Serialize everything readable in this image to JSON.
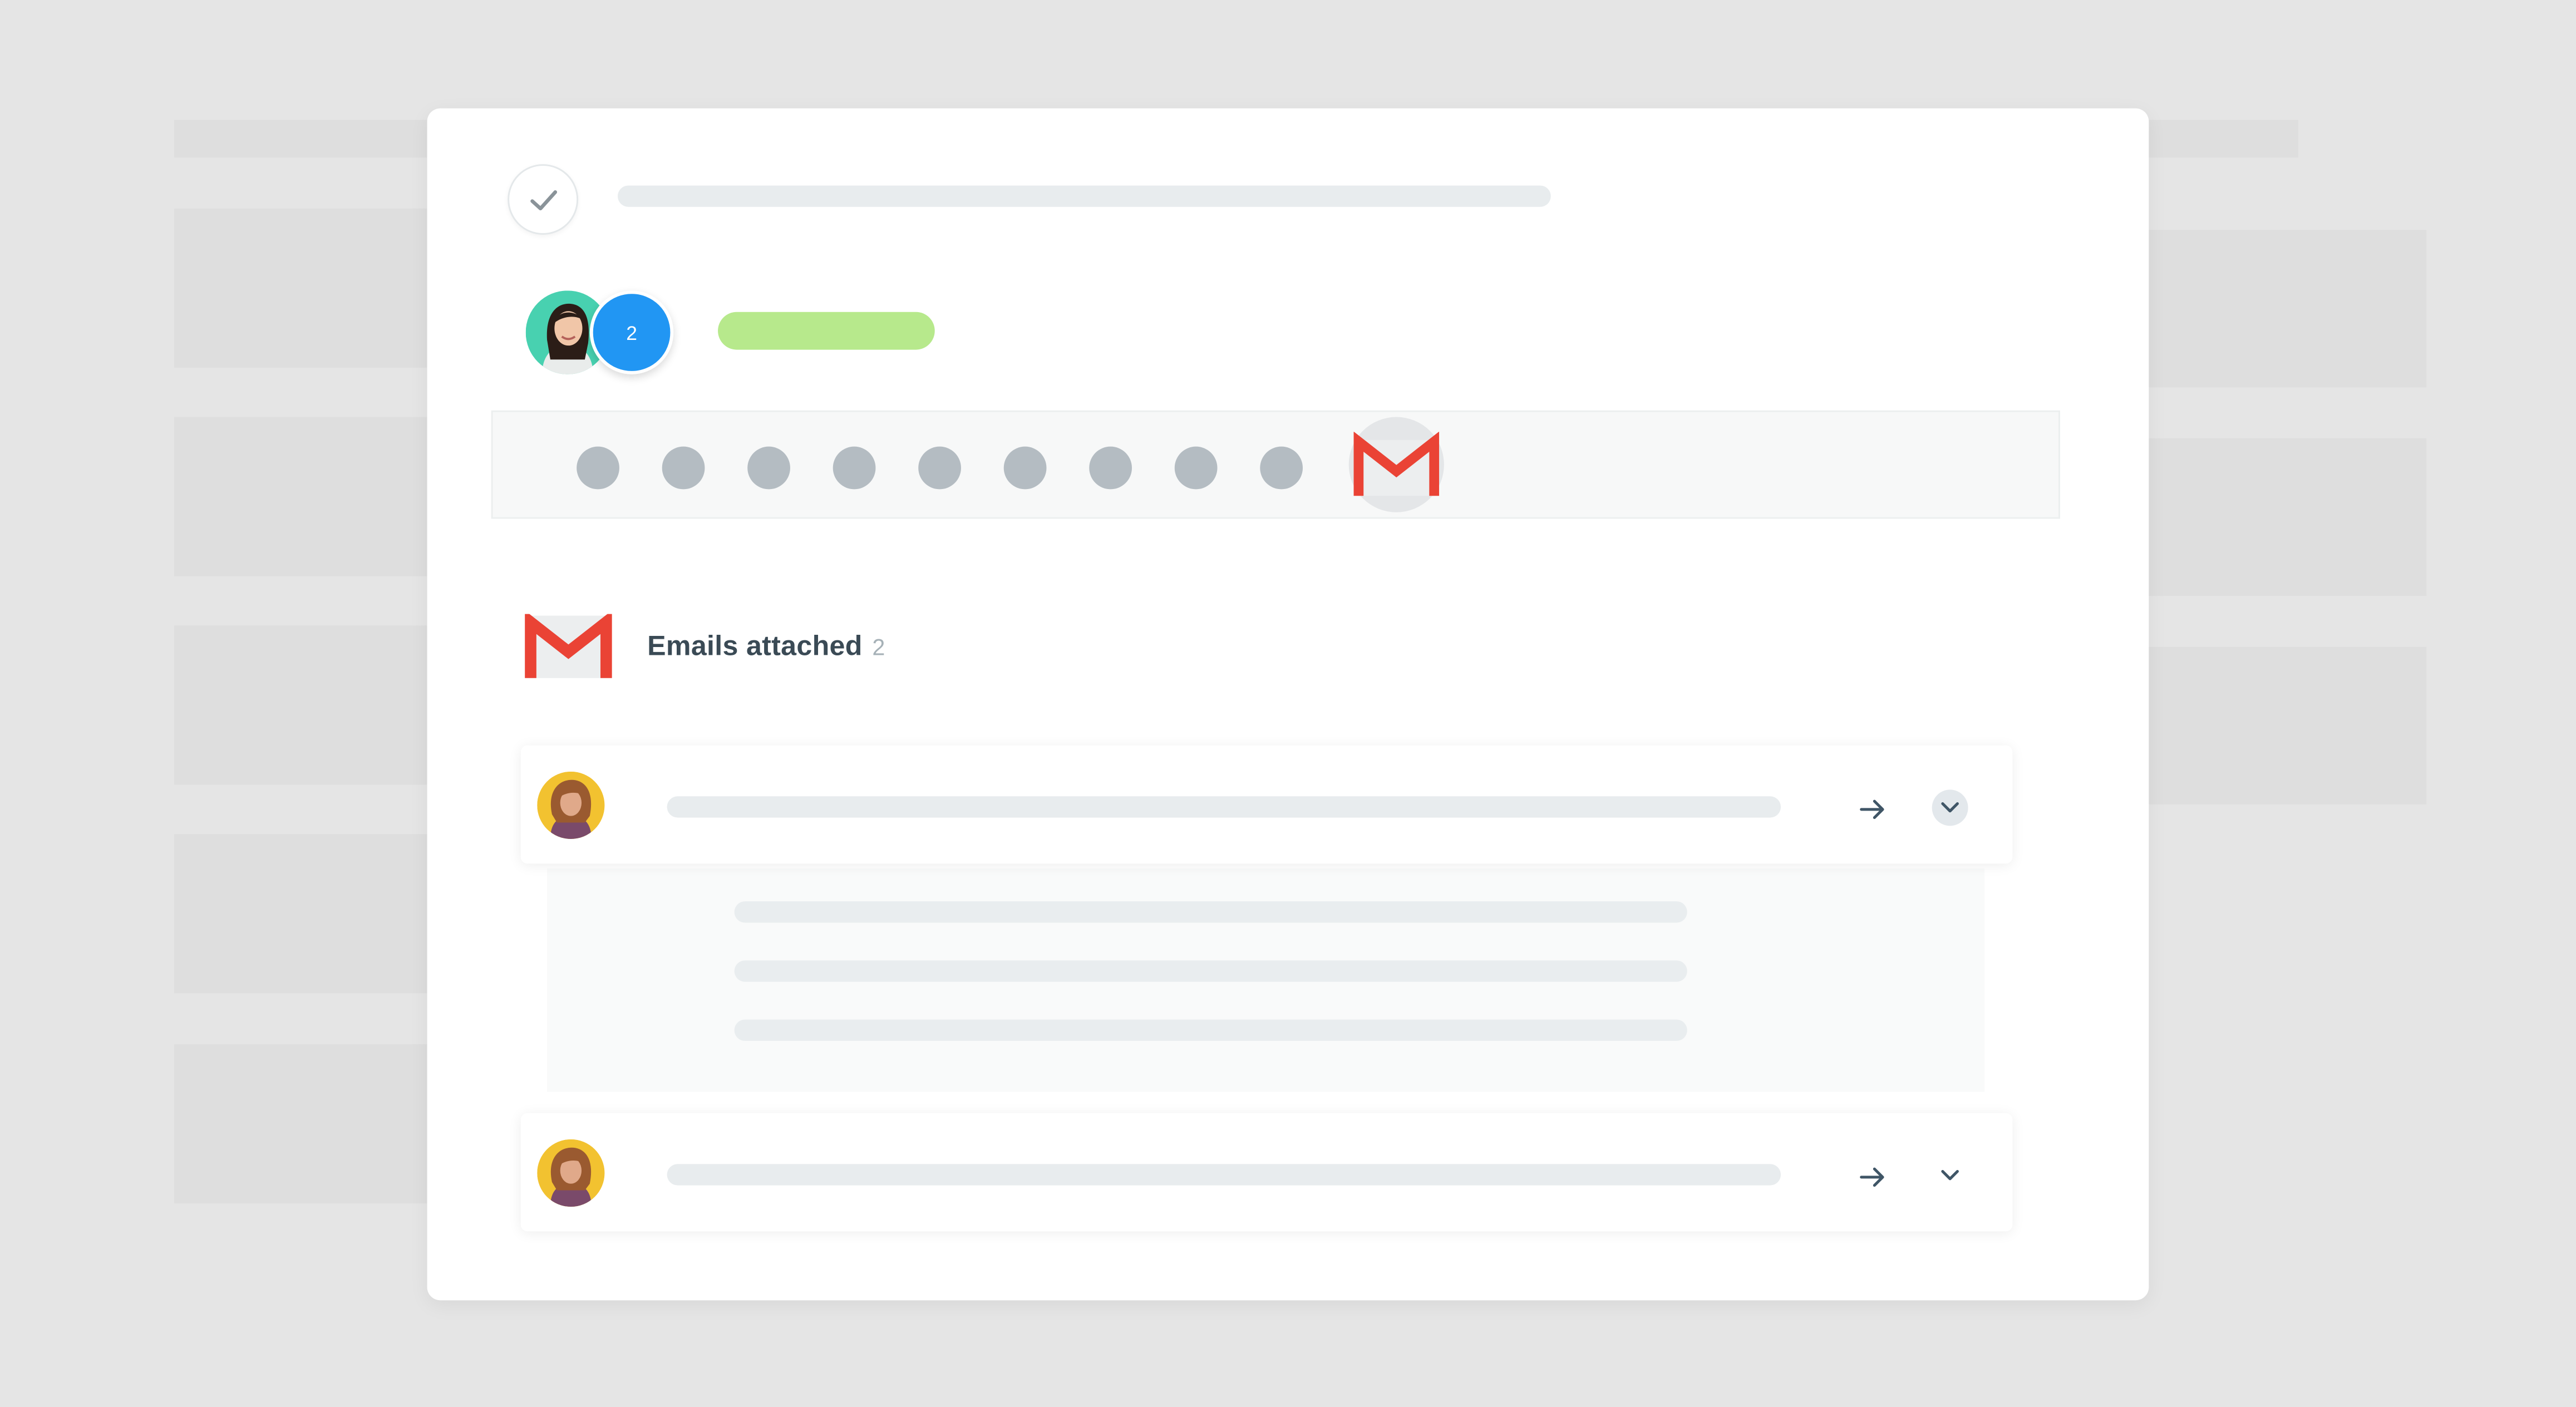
{
  "task": {
    "completed": true
  },
  "participants": {
    "extra_count": "2"
  },
  "activity_timeline": {
    "dot_count": 9,
    "active_item_icon": "gmail-icon"
  },
  "emails_section": {
    "title": "Emails attached",
    "count": "2",
    "icon": "gmail-icon",
    "emails": [
      {
        "expanded": true
      },
      {
        "expanded": false
      }
    ]
  },
  "colors": {
    "background": "#e5e5e5",
    "card": "#ffffff",
    "placeholder": "#e8ecee",
    "accent_blue": "#2196f3",
    "accent_green": "#b7e98c",
    "gmail_red": "#ea4335",
    "timeline_dot": "#b4bcc2",
    "title_text": "#3a4a55"
  }
}
